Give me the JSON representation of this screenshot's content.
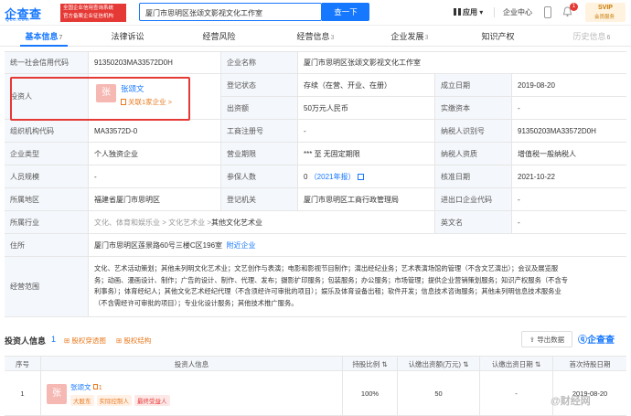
{
  "app": {
    "logo_text": "企查查",
    "logo_sub": "Qcc.com",
    "badge_line1": "全国企业信用查询系统",
    "badge_line2": "官方备案企业征信机构",
    "search_value": "厦门市思明区张颂文影视文化工作室",
    "search_button": "查一下",
    "nav_app": "应用",
    "nav_enterprise": "企业中心",
    "bell_count": "1",
    "svip_title": "SVIP",
    "svip_sub": "会员服务"
  },
  "tabs": [
    {
      "label": "基本信息",
      "count": "7"
    },
    {
      "label": "法律诉讼",
      "count": ""
    },
    {
      "label": "经营风险",
      "count": ""
    },
    {
      "label": "经营信息",
      "count": "3"
    },
    {
      "label": "企业发展",
      "count": "3"
    },
    {
      "label": "知识产权",
      "count": ""
    },
    {
      "label": "历史信息",
      "count": "6"
    }
  ],
  "info": {
    "credit_code_label": "统一社会信用代码",
    "credit_code": "91350203MA33572D0H",
    "company_name_label": "企业名称",
    "company_name": "厦门市思明区张颂文影视文化工作室",
    "investor_label": "投资人",
    "investor_avatar": "张",
    "investor_name": "张颂文",
    "investor_related": "关联1家企业 >",
    "reg_status_label": "登记状态",
    "reg_status": "存续（在营、开业、在册）",
    "founded_label": "成立日期",
    "founded": "2019-08-20",
    "capital_label": "出资额",
    "capital": "50万元人民币",
    "paid_capital_label": "实缴资本",
    "paid_capital": "-",
    "org_code_label": "组织机构代码",
    "org_code": "MA33572D-0",
    "reg_no_label": "工商注册号",
    "reg_no": "-",
    "taxpayer_id_label": "纳税人识别号",
    "taxpayer_id": "91350203MA33572D0H",
    "type_label": "企业类型",
    "type": "个人独资企业",
    "term_label": "营业期限",
    "term": "*** 至 无固定期限",
    "tax_qual_label": "纳税人资质",
    "tax_qual": "增值税一般纳税人",
    "staff_label": "人员规模",
    "staff": "-",
    "insured_label": "参保人数",
    "insured": "0",
    "insured_year": "（2021年报）",
    "approved_label": "核准日期",
    "approved": "2021-10-22",
    "region_label": "所属地区",
    "region": "福建省厦门市思明区",
    "authority_label": "登记机关",
    "authority": "厦门市思明区工商行政管理局",
    "import_code_label": "进出口企业代码",
    "import_code": "-",
    "industry_label": "所属行业",
    "industry_path": "文化、体育和娱乐业 > 文化艺术业 > ",
    "industry_leaf": "其他文化艺术业",
    "english_label": "英文名",
    "english": "-",
    "address_label": "住所",
    "address": "厦门市思明区莲景路60号三楼C区196室",
    "address_link": "附近企业",
    "scope_label": "经营范围",
    "scope_line1": "文化、艺术活动策划；其他未列明文化艺术业；文艺创作与表演；电影和影视节目制作；演出经纪业务；艺术表演场馆的管理（不含文艺演出）；会议及展览服",
    "scope_line2": "务；动画、漫画设计、制作；广告的设计、制作、代理、发布；摄影扩印服务；包装服务；办公服务；市场管理；提供企业营销策划服务；知识产权服务（不含专",
    "scope_line3": "利事务）；体育经纪人；其他文化艺术经纪代理（不含须经许可审批的项目）；娱乐及体育设备出租；软件开发；信息技术咨询服务；其他未列明信息技术服务业",
    "scope_line4": "（不含需经许可审批的项目）；专业化设计服务；其他技术推广服务。"
  },
  "investor_section": {
    "title": "投资人信息",
    "count": "1",
    "tool1": "股权穿透图",
    "tool2": "股权结构",
    "export": "导出数据",
    "watermark": "企查查",
    "headers": [
      "序号",
      "投资人信息",
      "持股比例",
      "认缴出资额(万元)",
      "认缴出资日期",
      "首次持股日期"
    ],
    "row": {
      "index": "1",
      "avatar": "张",
      "name": "张颂文",
      "related_count": "1",
      "tags": [
        "大股东",
        "实际控制人",
        "最终受益人"
      ],
      "ratio": "100%",
      "amount": "50",
      "sub_date": "-",
      "first_date": "2019-08-20"
    }
  },
  "weibo_wm": "@财经网"
}
